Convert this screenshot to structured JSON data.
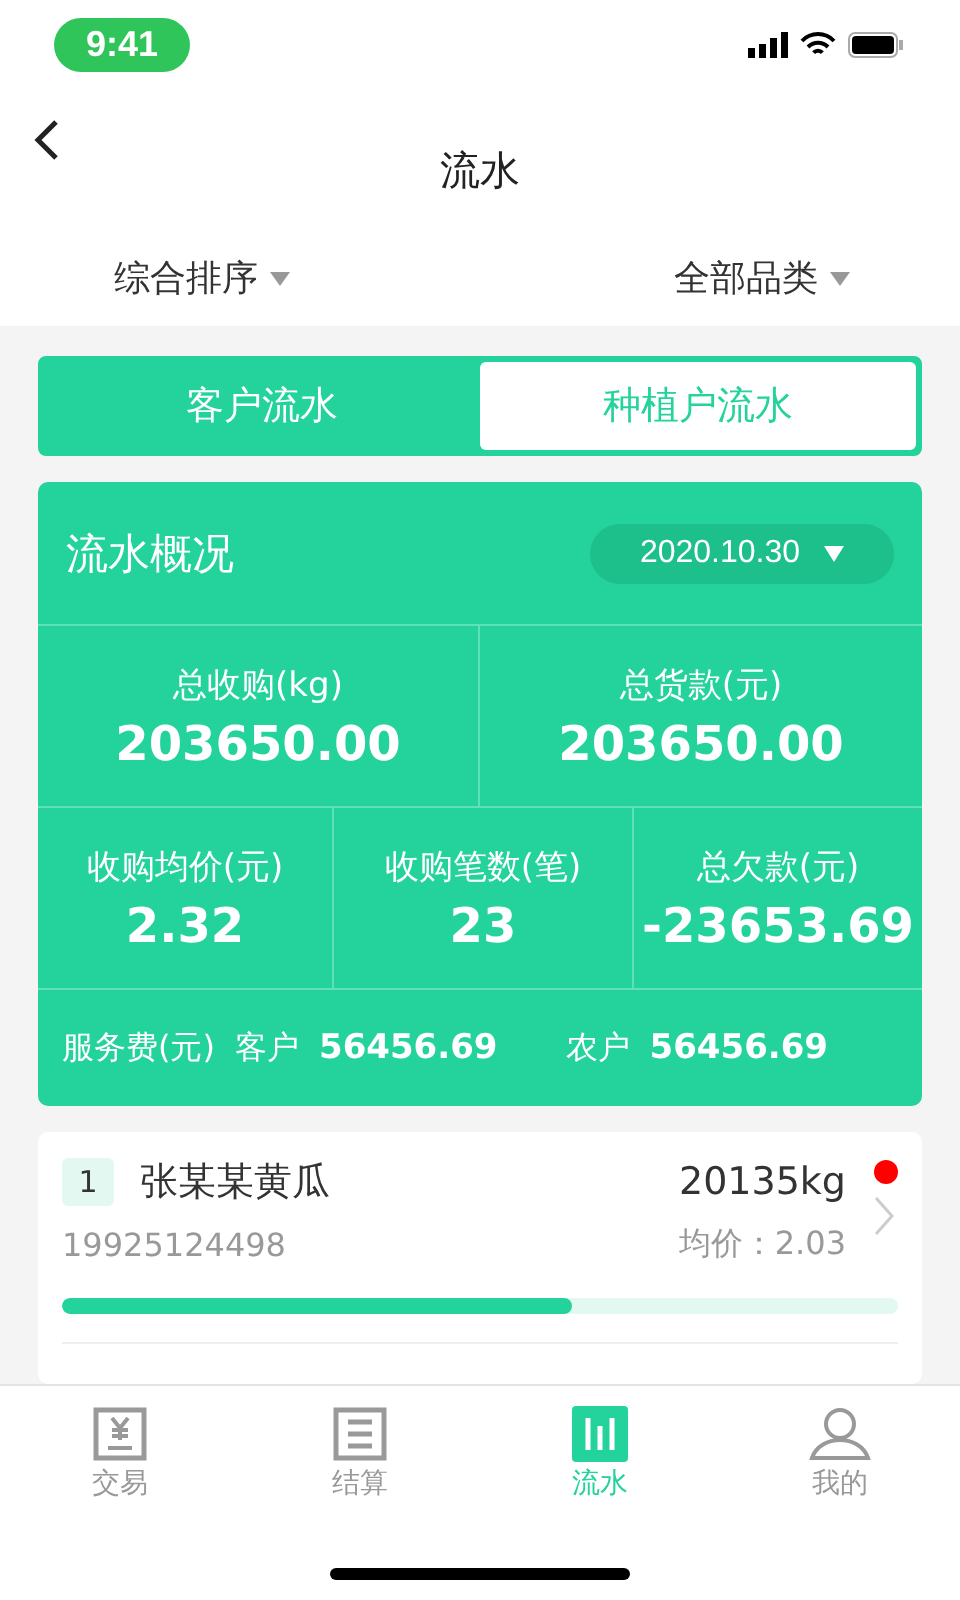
{
  "status_bar": {
    "time": "9:41"
  },
  "nav": {
    "title": "流水"
  },
  "filters": [
    {
      "label": "综合排序"
    },
    {
      "label": "全部品类"
    }
  ],
  "tabs": [
    {
      "label": "客户流水",
      "selected": false
    },
    {
      "label": "种植户流水",
      "selected": true
    }
  ],
  "summary": {
    "title": "流水概况",
    "date": "2020.10.30",
    "top_stats": [
      {
        "label": "总收购(kg)",
        "value": "203650.00"
      },
      {
        "label": "总货款(元)",
        "value": "203650.00"
      }
    ],
    "bottom_stats": [
      {
        "label": "收购均价(元)",
        "value": "2.32"
      },
      {
        "label": "收购笔数(笔)",
        "value": "23"
      },
      {
        "label": "总欠款(元)",
        "value": "-23653.69"
      }
    ],
    "service_fee": {
      "label": "服务费(元)",
      "parts": [
        {
          "label": "客户",
          "value": "56456.69"
        },
        {
          "label": "农户",
          "value": "56456.69"
        }
      ]
    }
  },
  "records": [
    {
      "rank": "1",
      "name": "张某某黄瓜",
      "weight": "20135kg",
      "phone": "19925124498",
      "avg_price": "均价：2.03",
      "unread": true,
      "level": 0.61
    }
  ],
  "tab_bar": [
    {
      "kind": "trade",
      "label": "交易",
      "selected": false
    },
    {
      "kind": "settle",
      "label": "结算",
      "selected": false
    },
    {
      "kind": "flow",
      "label": "流水",
      "selected": true
    },
    {
      "kind": "me",
      "label": "我的",
      "selected": false
    }
  ]
}
